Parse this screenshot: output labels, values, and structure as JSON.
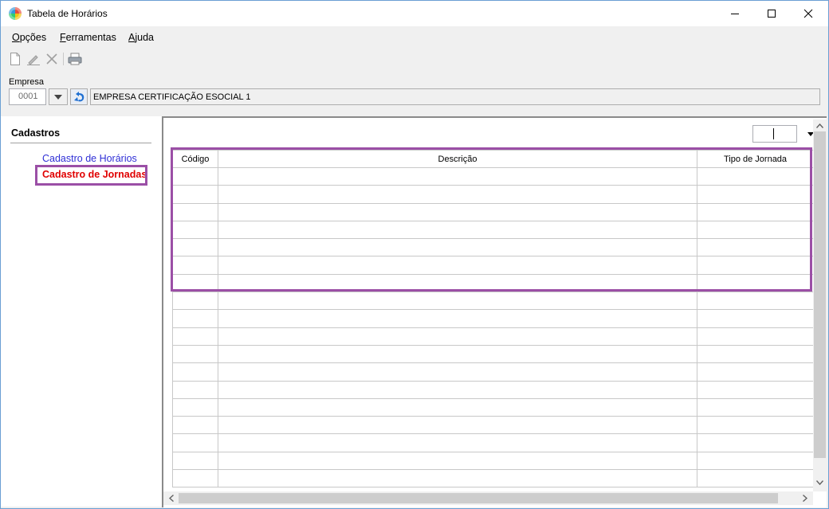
{
  "window": {
    "title": "Tabela de Horários"
  },
  "menu": {
    "items": [
      {
        "prefix": "",
        "mnemonic": "O",
        "rest": "pções"
      },
      {
        "prefix": "",
        "mnemonic": "F",
        "rest": "erramentas"
      },
      {
        "prefix": "",
        "mnemonic": "A",
        "rest": "juda"
      }
    ]
  },
  "toolbar": {
    "icons": [
      "new-document-icon",
      "edit-pencil-icon",
      "delete-x-icon",
      "print-icon"
    ]
  },
  "empresa": {
    "label": "Empresa",
    "code": "0001",
    "name": "EMPRESA CERTIFICAÇÃO ESOCIAL 1"
  },
  "cadastros": {
    "title": "Cadastros",
    "items": [
      {
        "label": "Cadastro de Horários",
        "selected": false,
        "color": "#2f2fd6"
      },
      {
        "label": "Cadastro de Jornadas",
        "selected": true,
        "color": "#e00000"
      }
    ]
  },
  "grid": {
    "columns": [
      "Código",
      "Descrição",
      "Tipo de Jornada"
    ],
    "rows": 18
  },
  "colors": {
    "highlight": "#9b4fa6",
    "link": "#2f2fd6",
    "selected_link": "#e00000"
  }
}
